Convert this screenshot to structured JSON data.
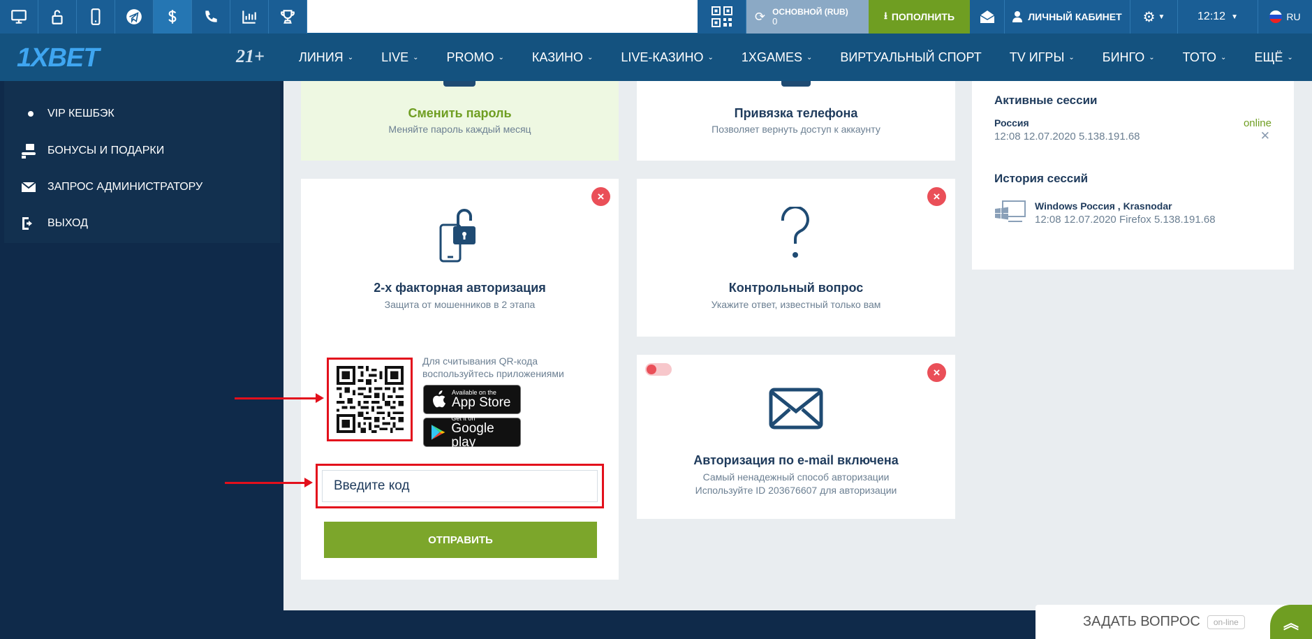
{
  "topbar": {
    "balance_label": "ОСНОВНОЙ (RUB)",
    "balance_value": "0",
    "deposit_label": "ПОПОЛНИТЬ",
    "cabinet_label": "ЛИЧНЫЙ КАБИНЕТ",
    "time": "12:12",
    "language": "RU",
    "icons": [
      "desktop-icon",
      "unlock-icon",
      "mobile-icon",
      "telegram-icon",
      "dollar-icon",
      "phone-icon",
      "stats-icon",
      "trophy-icon",
      "qr-icon",
      "refresh-icon",
      "download-icon",
      "envelope-icon",
      "user-icon",
      "gear-icon"
    ]
  },
  "nav": {
    "logo": "1XBET",
    "age": "21+",
    "items": [
      {
        "label": "ЛИНИЯ",
        "dropdown": true
      },
      {
        "label": "LIVE",
        "dropdown": true
      },
      {
        "label": "PROMO",
        "dropdown": true
      },
      {
        "label": "КАЗИНО",
        "dropdown": true
      },
      {
        "label": "LIVE-КАЗИНО",
        "dropdown": true
      },
      {
        "label": "1XGAMES",
        "dropdown": true
      },
      {
        "label": "ВИРТУАЛЬНЫЙ СПОРТ",
        "dropdown": false
      },
      {
        "label": "TV ИГРЫ",
        "dropdown": true
      },
      {
        "label": "БИНГО",
        "dropdown": true
      },
      {
        "label": "ТОТО",
        "dropdown": true
      },
      {
        "label": "ЕЩЁ",
        "dropdown": true
      }
    ]
  },
  "sidebar": {
    "items": [
      {
        "label": "VIP КЕШБЭК",
        "icon": "bullet-icon"
      },
      {
        "label": "БОНУСЫ И ПОДАРКИ",
        "icon": "gift-hand-icon"
      },
      {
        "label": "ЗАПРОС АДМИНИСТРАТОРУ",
        "icon": "envelope-icon"
      },
      {
        "label": "ВЫХОД",
        "icon": "logout-icon"
      }
    ]
  },
  "cards": {
    "password": {
      "title": "Сменить пароль",
      "subtitle": "Меняйте пароль каждый месяц"
    },
    "phone": {
      "title": "Привязка телефона",
      "subtitle": "Позволяет вернуть доступ к аккаунту"
    },
    "twofa": {
      "title": "2-х факторная авторизация",
      "subtitle": "Защита от мошенников в 2 этапа",
      "qr_hint": "Для считывания QR-кода воспользуйтесь приложениями",
      "appstore_small": "Available on the",
      "appstore_big": "App Store",
      "googleplay_small": "Get it on",
      "googleplay_big": "Google play",
      "code_placeholder": "Введите код",
      "submit_label": "ОТПРАВИТЬ"
    },
    "question": {
      "title": "Контрольный вопрос",
      "subtitle": "Укажите ответ, известный только вам"
    },
    "email": {
      "title": "Авторизация по e-mail включена",
      "subtitle_line1": "Самый ненадежный способ авторизации",
      "subtitle_line2": "Используйте ID 203676607 для авторизации"
    }
  },
  "sessions": {
    "active_title": "Активные сессии",
    "active": {
      "country": "Россия",
      "status": "online",
      "details": "12:08 12.07.2020 5.138.191.68"
    },
    "history_title": "История сессий",
    "history": {
      "title": "Windows Россия , Krasnodar",
      "details": "12:08 12.07.2020 Firefox 5.138.191.68"
    }
  },
  "chat": {
    "label": "ЗАДАТЬ ВОПРОС",
    "status": "on-line"
  },
  "colors": {
    "brand_blue": "#14527f",
    "accent_green": "#6f9e22",
    "close_red": "#ea4f58",
    "highlight_red": "#e3101c"
  }
}
